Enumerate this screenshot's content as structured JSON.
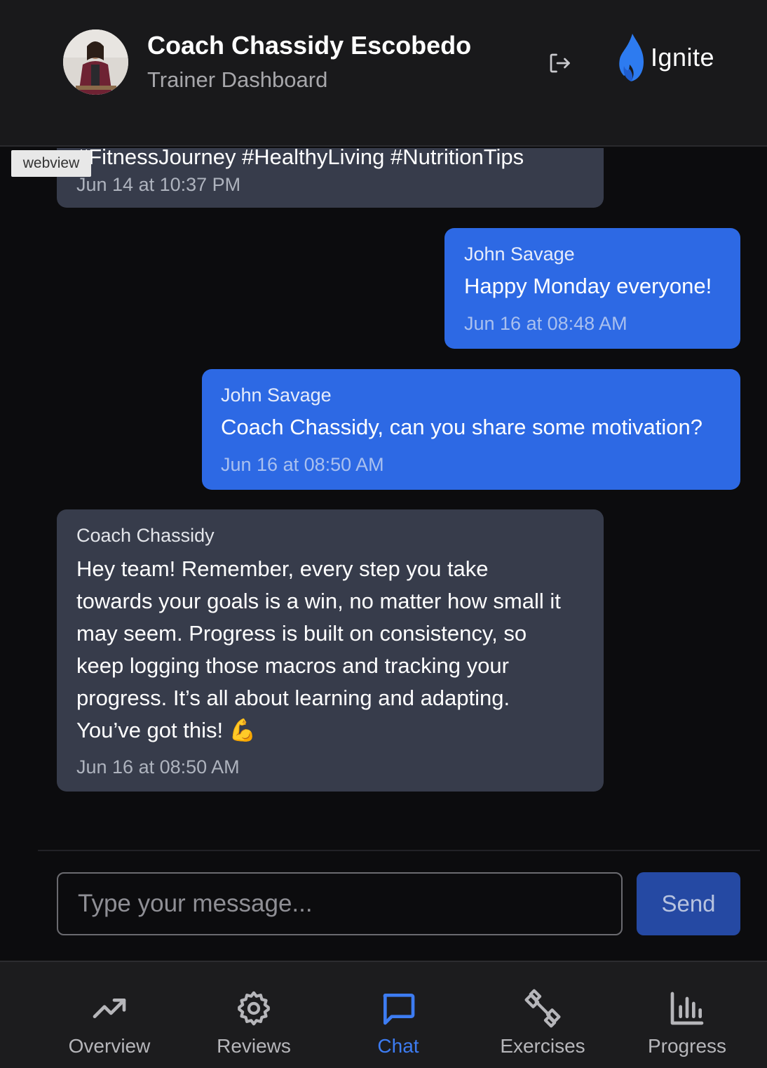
{
  "header": {
    "title": "Coach Chassidy Escobedo",
    "subtitle": "Trainer Dashboard",
    "logo_text": "Ignite",
    "logout_icon": "logout-icon"
  },
  "debug_tag": "webview",
  "messages": [
    {
      "direction": "incoming",
      "sender": "",
      "text": "#FitnessJourney #HealthyLiving #NutritionTips",
      "time": "Jun 14 at 10:37 PM"
    },
    {
      "direction": "outgoing",
      "sender": "John Savage",
      "text": "Happy Monday everyone!",
      "time": "Jun 16 at 08:48 AM"
    },
    {
      "direction": "outgoing",
      "sender": "John Savage",
      "text": "Coach Chassidy, can you share some motivation?",
      "time": "Jun 16 at 08:50 AM"
    },
    {
      "direction": "incoming",
      "sender": "Coach Chassidy",
      "text_lines": [
        "Hey team! Remember, every step you take",
        "towards your goals is a win, no matter how small it",
        "may seem. Progress is built on consistency, so",
        "keep logging those macros and tracking your",
        "progress. It’s all about learning and adapting.",
        "You’ve got this! 💪"
      ],
      "time": "Jun 16 at 08:50 AM"
    }
  ],
  "composer": {
    "placeholder": "Type your message...",
    "value": "",
    "send_label": "Send"
  },
  "nav": {
    "active": "Chat",
    "active_color": "#3d7cf2",
    "items": [
      {
        "label": "Overview",
        "icon": "trending-up-icon"
      },
      {
        "label": "Reviews",
        "icon": "gear-icon"
      },
      {
        "label": "Chat",
        "icon": "chat-bubble-icon"
      },
      {
        "label": "Exercises",
        "icon": "dumbbell-icon"
      },
      {
        "label": "Progress",
        "icon": "bar-chart-icon"
      }
    ]
  },
  "colors": {
    "background": "#0c0c0e",
    "outgoing_bubble": "#2d69e4",
    "incoming_bubble": "#373c4b",
    "send_button": "#2549a3"
  }
}
